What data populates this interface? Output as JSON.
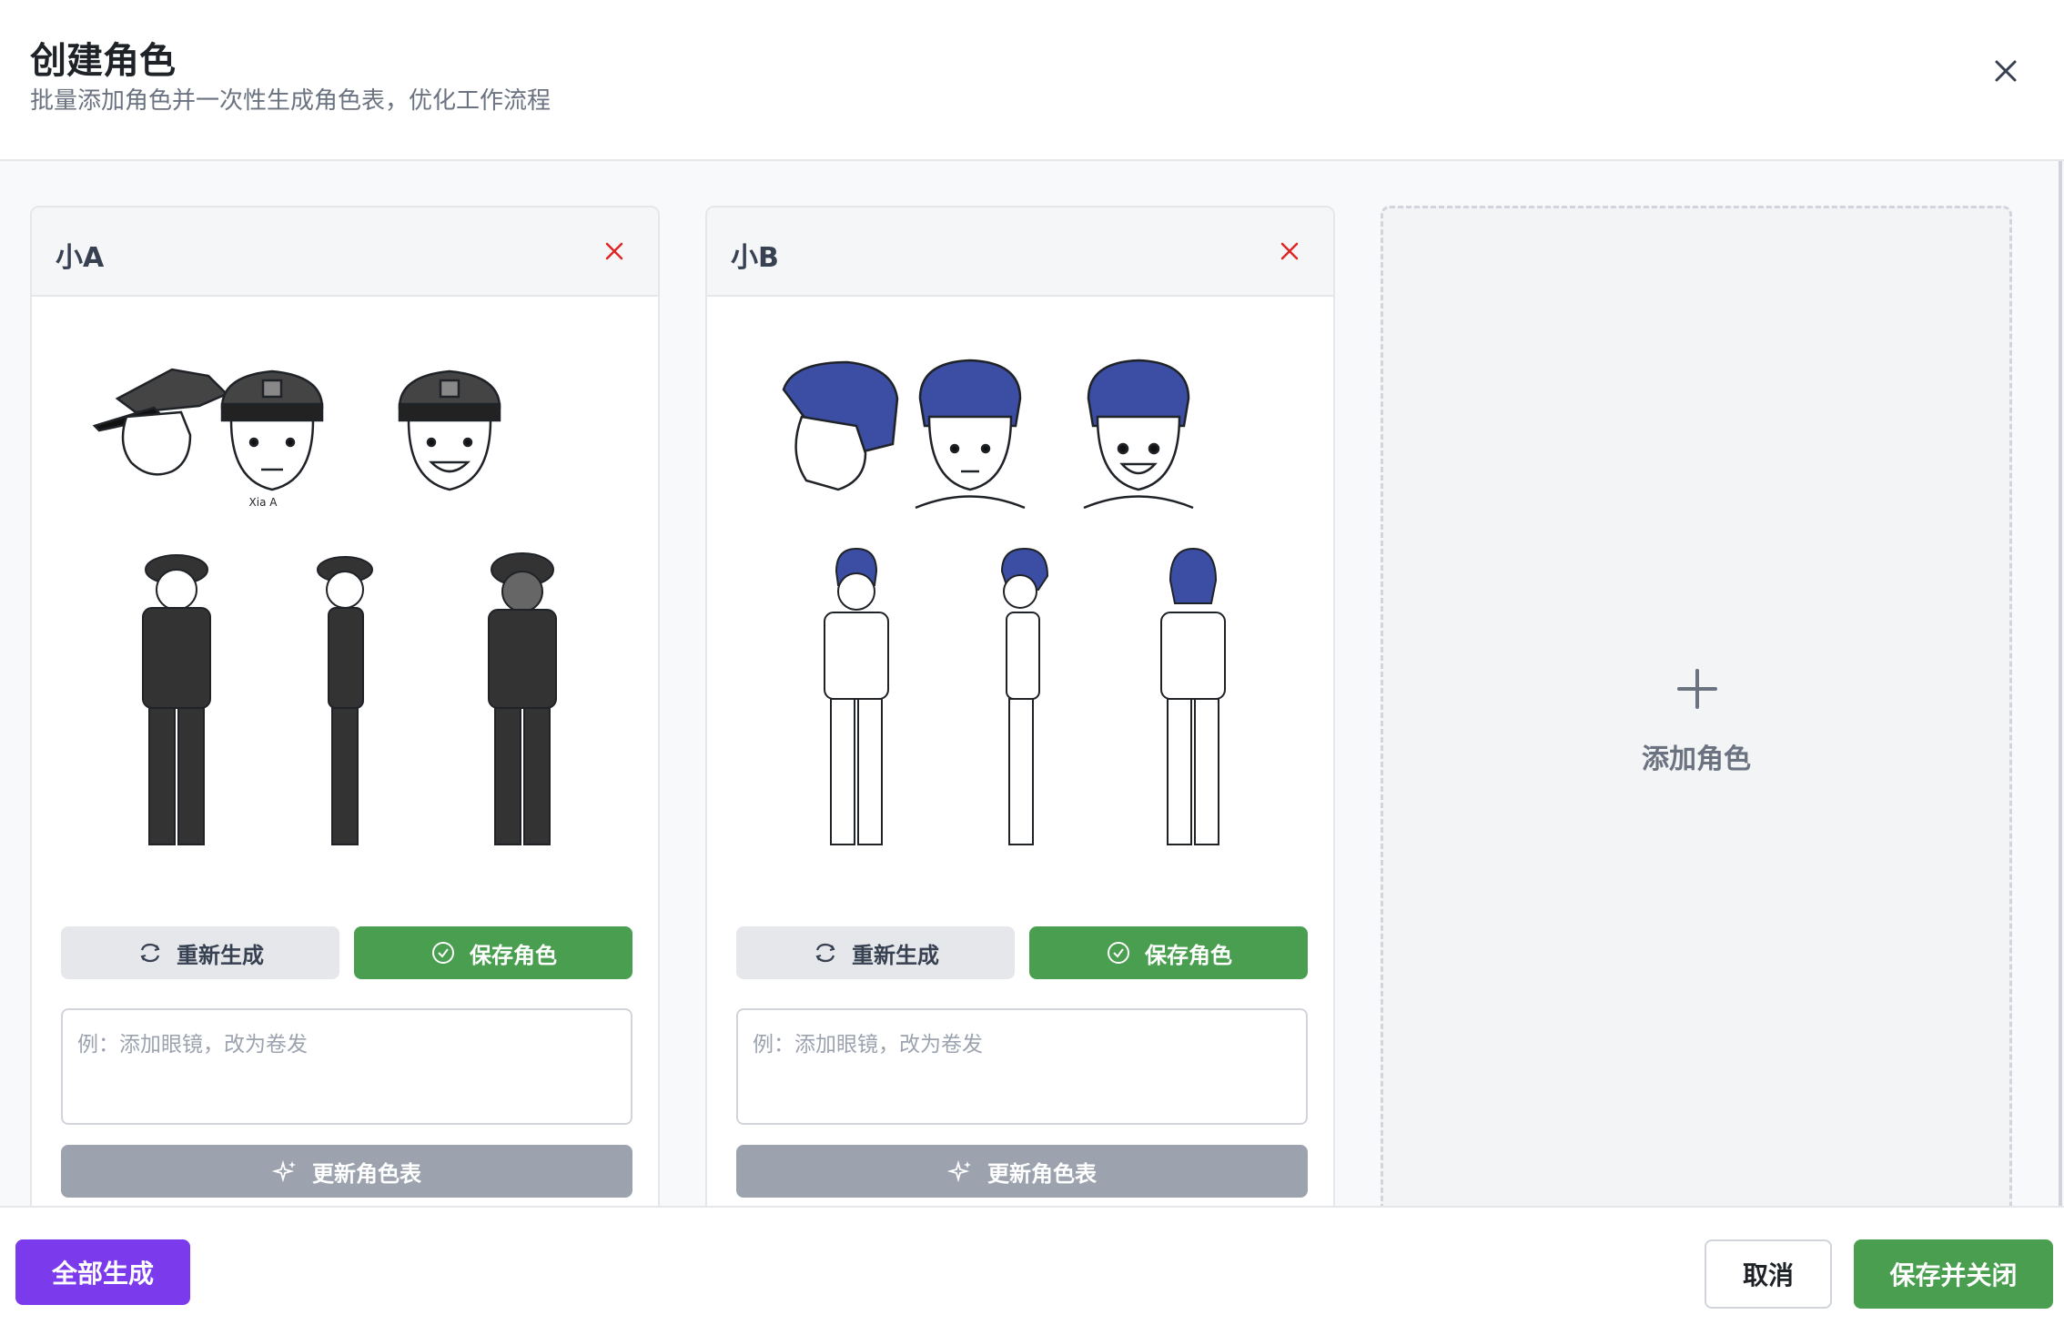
{
  "dialog": {
    "title": "创建角色",
    "subtitle": "批量添加角色并一次性生成角色表，优化工作流程",
    "close_icon": "close-icon"
  },
  "cards": [
    {
      "name": "小A",
      "sheet_caption": "Xia A",
      "regenerate_label": "重新生成",
      "save_label": "保存角色",
      "prompt_placeholder": "例：添加眼镜，改为卷发",
      "prompt_value": "",
      "update_label": "更新角色表"
    },
    {
      "name": "小B",
      "regenerate_label": "重新生成",
      "save_label": "保存角色",
      "prompt_placeholder": "例：添加眼镜，改为卷发",
      "prompt_value": "",
      "update_label": "更新角色表"
    }
  ],
  "add_card": {
    "label": "添加角色",
    "icon": "plus-icon"
  },
  "footer": {
    "generate_all_label": "全部生成",
    "cancel_label": "取消",
    "save_close_label": "保存并关闭"
  },
  "colors": {
    "save_green": "#4a9e4f",
    "generate_all_purple": "#7c3aed",
    "update_gray": "#9ca3af",
    "remove_red": "#dc2626",
    "hair_blue": "#3b4ea3"
  }
}
